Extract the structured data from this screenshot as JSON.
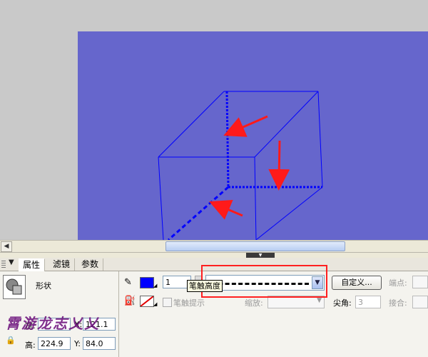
{
  "panel": {
    "tabs": [
      {
        "label": "属性",
        "active": true
      },
      {
        "label": "滤镜",
        "active": false
      },
      {
        "label": "参数",
        "active": false
      }
    ],
    "object_type": "形状",
    "stroke": {
      "color": "#0000ff",
      "height": "1",
      "style": "dashed"
    },
    "tooltip": "笔触高度",
    "custom_button": "自定义...",
    "stroke_hint": "笔触提示",
    "scale_label": "缩放:",
    "cap_label": "端点:",
    "join_label": "接合:",
    "miter_label": "尖角:",
    "miter_value": "3",
    "width_label": "宽:",
    "width_value": "121.1",
    "height_label": "高:",
    "height_value": "224.9",
    "x_label": "X:",
    "x_value": "",
    "y_label": "Y:",
    "y_value": "84.0"
  },
  "watermark": "霄游龙志乂乂"
}
